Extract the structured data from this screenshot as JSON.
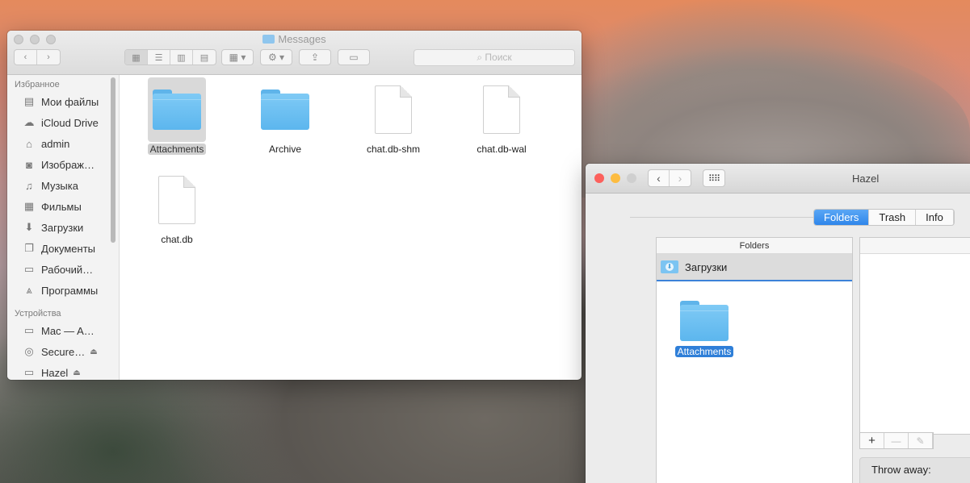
{
  "finder": {
    "title": "Messages",
    "search_placeholder": "Поиск",
    "sidebar": {
      "favorites_header": "Избранное",
      "favorites": [
        {
          "label": "Мои файлы",
          "icon": "all-my-files-icon"
        },
        {
          "label": "iCloud Drive",
          "icon": "cloud-icon"
        },
        {
          "label": "admin",
          "icon": "home-icon"
        },
        {
          "label": "Изображ…",
          "icon": "camera-icon"
        },
        {
          "label": "Музыка",
          "icon": "music-note-icon"
        },
        {
          "label": "Фильмы",
          "icon": "film-icon"
        },
        {
          "label": "Загрузки",
          "icon": "download-icon"
        },
        {
          "label": "Документы",
          "icon": "documents-icon"
        },
        {
          "label": "Рабочий…",
          "icon": "desktop-icon"
        },
        {
          "label": "Программы",
          "icon": "applications-icon"
        }
      ],
      "devices_header": "Устройства",
      "devices": [
        {
          "label": "Mac — A…",
          "icon": "computer-icon"
        },
        {
          "label": "Secure…",
          "icon": "disk-icon"
        },
        {
          "label": "Hazel",
          "icon": "disk-icon"
        }
      ]
    },
    "files": [
      {
        "name": "Attachments",
        "type": "folder",
        "selected": true
      },
      {
        "name": "Archive",
        "type": "folder",
        "selected": false
      },
      {
        "name": "chat.db-shm",
        "type": "document",
        "selected": false
      },
      {
        "name": "chat.db-wal",
        "type": "document",
        "selected": false
      },
      {
        "name": "chat.db",
        "type": "document",
        "selected": false
      }
    ]
  },
  "hazel": {
    "title": "Hazel",
    "tabs": [
      "Folders",
      "Trash",
      "Info"
    ],
    "active_tab": "Folders",
    "folders_header": "Folders",
    "selected_folder": "Загрузки",
    "dragged_item": "Attachments",
    "throw_away_label": "Throw away:",
    "colors": {
      "close": "#fc605c",
      "minimize": "#fdbc40",
      "zoom": "#cfcfcf",
      "accent": "#2f86ea"
    }
  }
}
